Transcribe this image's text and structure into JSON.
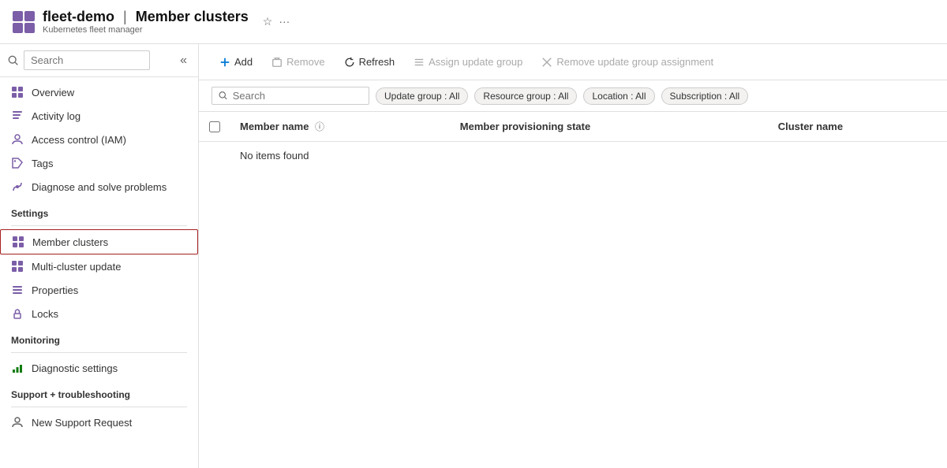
{
  "header": {
    "app_name": "fleet-demo",
    "separator": "|",
    "page_name": "Member clusters",
    "subtitle": "Kubernetes fleet manager",
    "star_icon": "☆",
    "ellipsis_icon": "···"
  },
  "sidebar": {
    "search_placeholder": "Search",
    "collapse_icon": "«",
    "nav_items": [
      {
        "id": "overview",
        "label": "Overview",
        "icon": "grid"
      },
      {
        "id": "activity-log",
        "label": "Activity log",
        "icon": "list"
      },
      {
        "id": "access-control",
        "label": "Access control (IAM)",
        "icon": "person"
      },
      {
        "id": "tags",
        "label": "Tags",
        "icon": "tag"
      },
      {
        "id": "diagnose",
        "label": "Diagnose and solve problems",
        "icon": "wrench"
      }
    ],
    "sections": [
      {
        "title": "Settings",
        "items": [
          {
            "id": "member-clusters",
            "label": "Member clusters",
            "icon": "grid-purple",
            "active": true
          },
          {
            "id": "multi-cluster-update",
            "label": "Multi-cluster update",
            "icon": "grid-purple"
          },
          {
            "id": "properties",
            "label": "Properties",
            "icon": "bars"
          },
          {
            "id": "locks",
            "label": "Locks",
            "icon": "lock"
          }
        ]
      },
      {
        "title": "Monitoring",
        "items": [
          {
            "id": "diagnostic-settings",
            "label": "Diagnostic settings",
            "icon": "chart-green"
          }
        ]
      },
      {
        "title": "Support + troubleshooting",
        "items": [
          {
            "id": "new-support-request",
            "label": "New Support Request",
            "icon": "person-gray"
          }
        ]
      }
    ]
  },
  "toolbar": {
    "add_label": "Add",
    "remove_label": "Remove",
    "refresh_label": "Refresh",
    "assign_update_group_label": "Assign update group",
    "remove_update_group_assignment_label": "Remove update group assignment"
  },
  "filter_bar": {
    "search_placeholder": "Search",
    "pills": [
      {
        "id": "update-group",
        "label": "Update group : All"
      },
      {
        "id": "resource-group",
        "label": "Resource group : All"
      },
      {
        "id": "location",
        "label": "Location : All"
      },
      {
        "id": "subscription",
        "label": "Subscription : All"
      }
    ]
  },
  "table": {
    "columns": [
      {
        "id": "checkbox",
        "label": ""
      },
      {
        "id": "member-name",
        "label": "Member name",
        "info": true
      },
      {
        "id": "member-provisioning-state",
        "label": "Member provisioning state"
      },
      {
        "id": "cluster-name",
        "label": "Cluster name"
      }
    ],
    "empty_message": "No items found"
  }
}
